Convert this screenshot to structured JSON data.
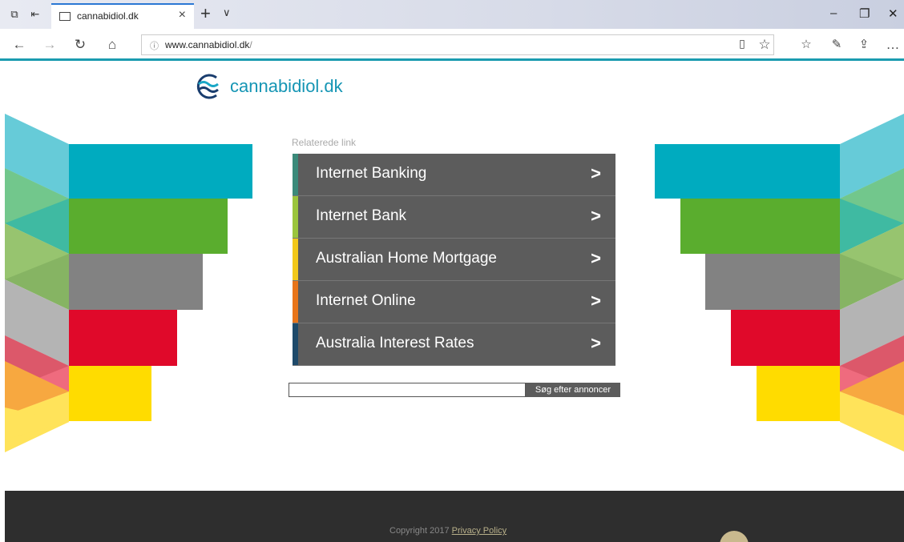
{
  "browser": {
    "tab_title": "cannabidiol.dk",
    "url_host": "www.cannabidiol.dk",
    "url_path": "/"
  },
  "page": {
    "logo_text": "cannabidiol.dk",
    "related_label": "Relaterede link",
    "links": [
      {
        "label": "Internet Banking",
        "accent": "#3b8a7a"
      },
      {
        "label": "Internet Bank",
        "accent": "#9bc53d"
      },
      {
        "label": "Australian Home Mortgage",
        "accent": "#f2c81a"
      },
      {
        "label": "Internet Online",
        "accent": "#e8751a"
      },
      {
        "label": "Australia Interest Rates",
        "accent": "#1e4a6a"
      }
    ],
    "search_button": "Søg efter annoncer",
    "copyright_prefix": "Copyright 2017",
    "privacy_policy": "Privacy Policy"
  },
  "colors": {
    "teal": "#00abbf",
    "green": "#5aad2e",
    "gray": "#828282",
    "red": "#e0092a",
    "yellow": "#ffdc00",
    "brand": "#1595b4"
  }
}
